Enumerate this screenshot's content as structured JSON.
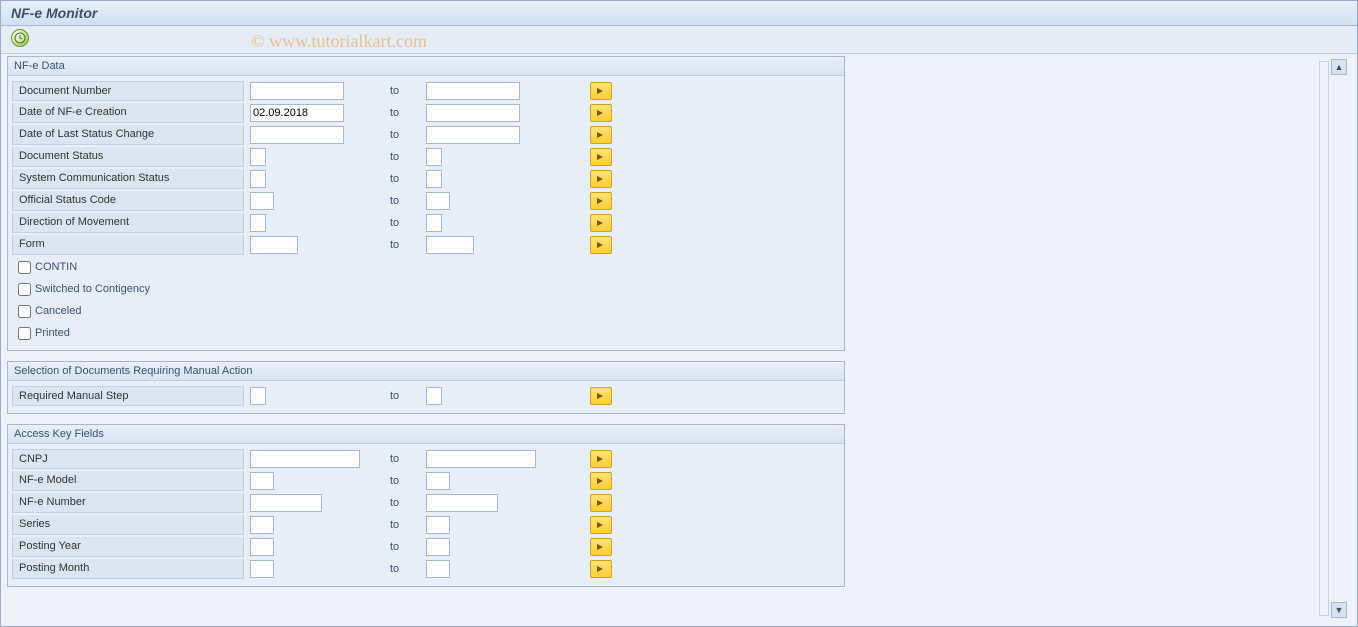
{
  "title": "NF-e Monitor",
  "watermark": "© www.tutorialkart.com",
  "to_label": "to",
  "groups": {
    "nfe_data": {
      "title": "NF-e Data",
      "rows": {
        "docnum": {
          "label": "Document Number",
          "from": "",
          "to": ""
        },
        "credate": {
          "label": "Date of NF-e Creation",
          "from": "02.09.2018",
          "to": ""
        },
        "lastchg": {
          "label": "Date of Last Status Change",
          "from": "",
          "to": ""
        },
        "docstat": {
          "label": "Document Status",
          "from": "",
          "to": ""
        },
        "syscomm": {
          "label": "System Communication Status",
          "from": "",
          "to": ""
        },
        "offcode": {
          "label": "Official Status Code",
          "from": "",
          "to": ""
        },
        "dirmove": {
          "label": "Direction of Movement",
          "from": "",
          "to": ""
        },
        "form": {
          "label": "Form",
          "from": "",
          "to": ""
        }
      },
      "checks": {
        "contin": {
          "label": "CONTIN",
          "checked": false
        },
        "switched": {
          "label": "Switched to Contigency",
          "checked": false
        },
        "canceled": {
          "label": "Canceled",
          "checked": false
        },
        "printed": {
          "label": "Printed",
          "checked": false
        }
      }
    },
    "manual": {
      "title": "Selection of Documents Requiring Manual Action",
      "rows": {
        "reqstep": {
          "label": "Required Manual Step",
          "from": "",
          "to": ""
        }
      }
    },
    "access": {
      "title": "Access Key Fields",
      "rows": {
        "cnpj": {
          "label": "CNPJ",
          "from": "",
          "to": ""
        },
        "model": {
          "label": "NF-e Model",
          "from": "",
          "to": ""
        },
        "nfenum": {
          "label": "NF-e Number",
          "from": "",
          "to": ""
        },
        "series": {
          "label": "Series",
          "from": "",
          "to": ""
        },
        "pyear": {
          "label": "Posting Year",
          "from": "",
          "to": ""
        },
        "pmonth": {
          "label": "Posting Month",
          "from": "",
          "to": ""
        }
      }
    }
  }
}
